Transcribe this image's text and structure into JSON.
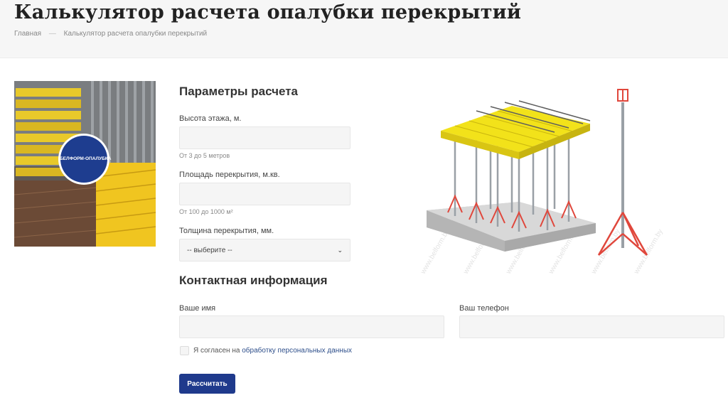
{
  "header": {
    "title": "Калькулятор расчета опалубки перекрытий",
    "breadcrumb": [
      {
        "label": "Главная"
      },
      {
        "label": "Калькулятор расчета опалубки перекрытий"
      }
    ]
  },
  "photo": {
    "badge_text": "БЕЛФОРМ-ОПАЛУБКА"
  },
  "params": {
    "title": "Параметры расчета",
    "height": {
      "label": "Высота этажа, м.",
      "value": "",
      "hint": "От 3 до 5 метров"
    },
    "area": {
      "label": "Площадь перекрытия, м.кв.",
      "value": "",
      "hint": "От 100 до 1000 м²"
    },
    "thickness": {
      "label": "Толщина перекрытия, мм.",
      "selected": "-- выберите --"
    }
  },
  "contact": {
    "title": "Контактная информация",
    "name": {
      "label": "Ваше имя",
      "value": ""
    },
    "phone": {
      "label": "Ваш телефон",
      "value": ""
    },
    "consent_prefix": "Я согласен на ",
    "consent_link": "обработку персональных данных"
  },
  "submit_label": "Рассчитать",
  "watermark": "www.belform.by",
  "colors": {
    "accent": "#1f3a8c",
    "link": "#2d4e8a",
    "formwork_yellow": "#f2e21a",
    "tripod_red": "#e0473c"
  }
}
